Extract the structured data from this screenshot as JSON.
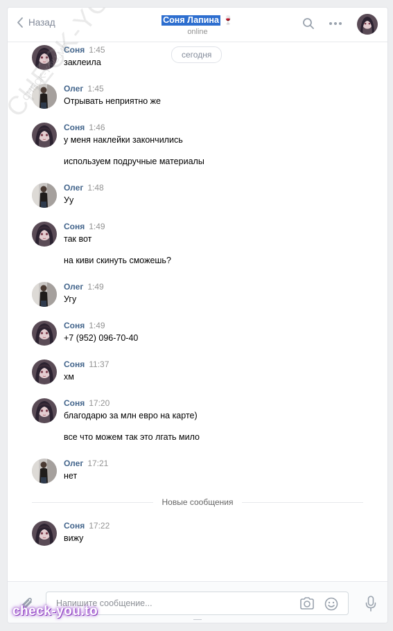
{
  "header": {
    "back_label": "Назад",
    "title": "Соня Лапина",
    "title_emoji": "🍷",
    "status": "online",
    "icons": [
      "search-icon",
      "more-icon"
    ]
  },
  "feed": {
    "date_separator": "сегодня",
    "new_messages_label": "Новые сообщения",
    "messages": [
      {
        "author": "Соня",
        "time": "1:45",
        "lines": [
          "заклеила"
        ]
      },
      {
        "author": "Олег",
        "time": "1:45",
        "lines": [
          "Отрывать неприятно же"
        ]
      },
      {
        "author": "Соня",
        "time": "1:46",
        "lines": [
          "у меня наклейки закончились",
          "используем подручные материалы"
        ]
      },
      {
        "author": "Олег",
        "time": "1:48",
        "lines": [
          "Уу"
        ]
      },
      {
        "author": "Соня",
        "time": "1:49",
        "lines": [
          "так вот",
          "на киви скинуть сможешь?"
        ]
      },
      {
        "author": "Олег",
        "time": "1:49",
        "lines": [
          "Угу"
        ]
      },
      {
        "author": "Соня",
        "time": "1:49",
        "lines": [
          "+7 (952) 096-70-40"
        ]
      },
      {
        "author": "Соня",
        "time": "11:37",
        "lines": [
          "хм"
        ]
      },
      {
        "author": "Соня",
        "time": "17:20",
        "lines": [
          "благодарю за млн евро на карте)",
          "все что можем так это лгать мило"
        ]
      },
      {
        "author": "Олег",
        "time": "17:21",
        "lines": [
          "нет"
        ]
      },
      {
        "author": "Соня",
        "time": "17:22",
        "lines": [
          "вижу"
        ]
      }
    ]
  },
  "composer": {
    "placeholder": "Напишите сообщение...",
    "icons": [
      "paperclip-icon",
      "camera-icon",
      "smile-icon",
      "microphone-icon"
    ]
  },
  "watermarks": {
    "diagonal": "CHECK-YOU.ME",
    "small": "CHECK-YOU.ME",
    "badge": "check-you.to"
  },
  "colors": {
    "author": "#42648b",
    "title_highlight": "#2d6ecf",
    "background": "#edeef0"
  }
}
